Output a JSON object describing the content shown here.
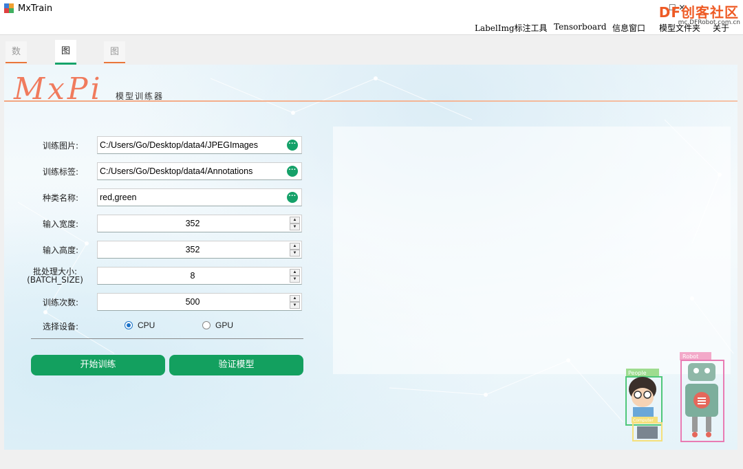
{
  "window": {
    "title": "MxTrain",
    "watermark": "DF创客社区",
    "watermark_sub": "mc.DFRobot.com.cn",
    "controls": "–  ☐  ✕"
  },
  "menu": [
    "LabelImg标注工具",
    "Tensorboard",
    "信息窗口",
    "模型文件夹",
    "关于"
  ],
  "tabs": [
    {
      "label": "数据采集",
      "active": false
    },
    {
      "label": "图像识别",
      "active": true
    },
    {
      "label": "图像分类",
      "active": false
    }
  ],
  "header": {
    "logo": "MxPi",
    "subtitle": "模型训练器"
  },
  "form": {
    "train_images": {
      "label": "训练图片:",
      "value": "C:/Users/Go/Desktop/data4/JPEGImages"
    },
    "train_labels": {
      "label": "训练标签:",
      "value": "C:/Users/Go/Desktop/data4/Annotations"
    },
    "class_names": {
      "label": "种类名称:",
      "value": "red,green"
    },
    "input_width": {
      "label": "输入宽度:",
      "value": "352"
    },
    "input_height": {
      "label": "输入高度:",
      "value": "352"
    },
    "batch_size": {
      "label": "批处理大小:",
      "label2": "(BATCH_SIZE)",
      "value": "8"
    },
    "epochs": {
      "label": "训练次数:",
      "value": "500"
    },
    "device": {
      "label": "选择设备:",
      "options": [
        "CPU",
        "GPU"
      ],
      "selected": "CPU"
    }
  },
  "buttons": {
    "start": "开始训练",
    "verify": "验证模型"
  },
  "illustration": {
    "people_tag": "People",
    "robot_tag": "Robot",
    "computer_tag": "Computer"
  },
  "colors": {
    "accent_green": "#13a05f",
    "tab_orange": "#e9763a",
    "logo_orange": "#f07b5d"
  }
}
